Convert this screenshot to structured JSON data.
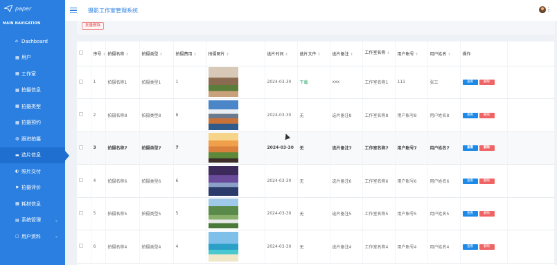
{
  "sidebar": {
    "logo_text": "paper",
    "caption": "MAIN NAVIGATION",
    "items": [
      {
        "icon": "⌂",
        "label": "Dashboard"
      },
      {
        "icon": "▦",
        "label": "用户"
      },
      {
        "icon": "▦",
        "label": "工作室"
      },
      {
        "icon": "▦",
        "label": "拍摄信息"
      },
      {
        "icon": "▦",
        "label": "拍摄类型"
      },
      {
        "icon": "▦",
        "label": "拍摄预约"
      },
      {
        "icon": "◍",
        "label": "跟进拍摄"
      },
      {
        "icon": "▬",
        "label": "选片信息"
      },
      {
        "icon": "◐",
        "label": "照片交付"
      },
      {
        "icon": "⚑",
        "label": "拍摄评价"
      },
      {
        "icon": "▦",
        "label": "耗材信息"
      },
      {
        "icon": "▤",
        "label": "系统管理",
        "expand": "⌄"
      },
      {
        "icon": "▢",
        "label": "用户资料",
        "expand": "⌄"
      }
    ],
    "active_index": 7
  },
  "header": {
    "title": "摄影工作室管理系统",
    "kebab": "⋮"
  },
  "toolbar": {
    "batch_delete": "批量删除"
  },
  "table": {
    "columns": [
      "序号",
      "拍摄名称",
      "拍摄类型",
      "拍摄费用",
      "拍摄图片",
      "选片时间",
      "选片文件",
      "选片备注",
      "工作室名称",
      "用户账号",
      "用户姓名",
      "操作"
    ],
    "sort_glyph": "⇕",
    "view_label": "查看",
    "delete_label": "删除",
    "rows": [
      {
        "no": "1",
        "name": "拍摄名称1",
        "type": "拍摄类型1",
        "fee": "1",
        "date": "2024-03-30",
        "file": "下载",
        "remark": "xxx",
        "studio": "工作室名称1",
        "account": "111",
        "username": "张三"
      },
      {
        "no": "2",
        "name": "拍摄名称8",
        "type": "拍摄类型8",
        "fee": "8",
        "date": "2024-03-30",
        "file": "无",
        "remark": "选片备注8",
        "studio": "工作室名称8",
        "account": "用户账号8",
        "username": "用户姓名8"
      },
      {
        "no": "3",
        "name": "拍摄名称7",
        "type": "拍摄类型7",
        "fee": "7",
        "date": "2024-03-30",
        "file": "无",
        "remark": "选片备注7",
        "studio": "工作室名称7",
        "account": "用户账号7",
        "username": "用户姓名7"
      },
      {
        "no": "4",
        "name": "拍摄名称6",
        "type": "拍摄类型6",
        "fee": "6",
        "date": "2024-03-30",
        "file": "无",
        "remark": "选片备注6",
        "studio": "工作室名称6",
        "account": "用户账号6",
        "username": "用户姓名6"
      },
      {
        "no": "5",
        "name": "拍摄名称5",
        "type": "拍摄类型5",
        "fee": "5",
        "date": "2024-03-30",
        "file": "无",
        "remark": "选片备注5",
        "studio": "工作室名称5",
        "account": "用户账号5",
        "username": "用户姓名5"
      },
      {
        "no": "6",
        "name": "拍摄名称4",
        "type": "拍摄类型4",
        "fee": "4",
        "date": "2024-03-30",
        "file": "无",
        "remark": "选片备注4",
        "studio": "工作室名称4",
        "account": "用户账号4",
        "username": "用户姓名4"
      }
    ],
    "highlighted_row": 2
  },
  "colors": {
    "sidebar_bg": "#2a7fe0",
    "view_btn": "#1e8ae8",
    "delete_btn": "#ef6464",
    "download_link": "#2aa56c"
  }
}
